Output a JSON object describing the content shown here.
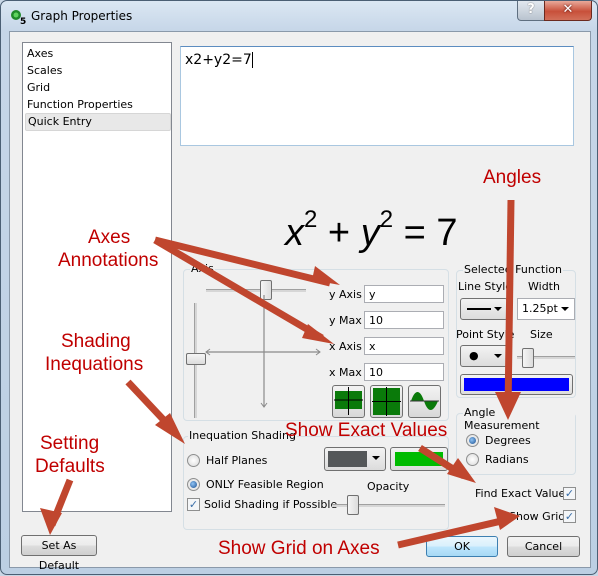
{
  "window": {
    "title": "Graph Properties",
    "help_label": "?",
    "close_label": "✕"
  },
  "sidebar": {
    "items": [
      {
        "label": "Axes",
        "selected": false
      },
      {
        "label": "Scales",
        "selected": false
      },
      {
        "label": "Grid",
        "selected": false
      },
      {
        "label": "Function Properties",
        "selected": false
      },
      {
        "label": "Quick Entry",
        "selected": true
      }
    ]
  },
  "entry": {
    "value": "x2+y2=7"
  },
  "formula": {
    "x": "x",
    "exp1": "2",
    "plus": "+",
    "y": "y",
    "exp2": "2",
    "rhs": "= 7"
  },
  "axis_group": {
    "label": "Axis",
    "y_axis_label": "y Axis",
    "y_axis_value": "y",
    "y_max_label": "y Max",
    "y_max_value": "10",
    "x_axis_label": "x Axis",
    "x_axis_value": "x",
    "x_max_label": "x Max",
    "x_max_value": "10",
    "buttons": [
      "axes-shaded-band",
      "axes-filled-quadrants",
      "sine-curve-fill"
    ]
  },
  "selected_function": {
    "label": "Selected Function",
    "line_style_label": "Line Style",
    "width_label": "Width",
    "width_value": "1.25pt",
    "point_style_label": "Point Style",
    "size_label": "Size",
    "point_symbol": "●",
    "color": "#0000ff"
  },
  "angle": {
    "label": "Angle Measurement",
    "degrees_label": "Degrees",
    "radians_label": "Radians",
    "selected": "Degrees"
  },
  "shading": {
    "label": "Inequation Shading",
    "half_planes_label": "Half Planes",
    "feasible_label": "ONLY Feasible Region",
    "solid_label": "Solid Shading if Possible",
    "solid_checked": true,
    "opacity_label": "Opacity",
    "shade_color": "#545759",
    "fill_color": "#00bb00"
  },
  "options": {
    "find_exact_label": "Find Exact Values",
    "find_exact_checked": true,
    "show_grid_label": "Show Grid",
    "show_grid_checked": true
  },
  "buttons": {
    "default_label": "Set As Default",
    "ok_label": "OK",
    "cancel_label": "Cancel"
  },
  "annotations": {
    "axes": "Axes\nAnnotations",
    "axes_line1": "Axes",
    "axes_line2": "Annotations",
    "angles": "Angles",
    "shading_line1": "Shading",
    "shading_line2": "Inequations",
    "defaults_line1": "Setting",
    "defaults_line2": "Defaults",
    "exact": "Show Exact Values",
    "grid": "Show Grid on Axes",
    "color": "#c00000",
    "arrow_color": "#c0462e"
  },
  "check_glyph": "✓"
}
